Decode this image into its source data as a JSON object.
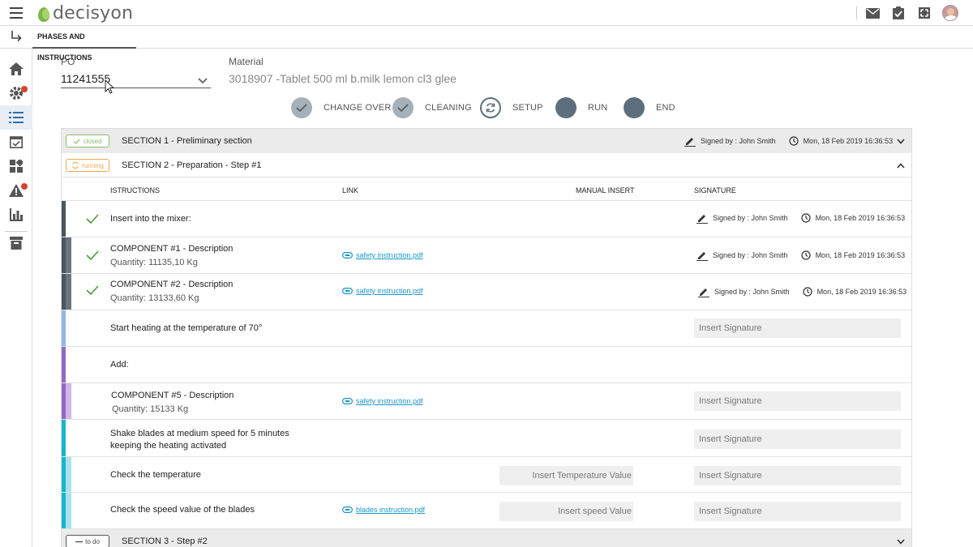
{
  "app": {
    "logo_text": "decisyon"
  },
  "subbar": {
    "tab_label": "PHASES AND INSTRUCTIONS"
  },
  "form": {
    "po_label": "PO",
    "po_value": "11241555",
    "material_label": "Material",
    "material_value": "3018907 -Tablet 500 ml b.milk lemon cl3 glee"
  },
  "phases": [
    {
      "label": "CHANGE OVER",
      "state": "done"
    },
    {
      "label": "CLEANING",
      "state": "done"
    },
    {
      "label": "SETUP",
      "state": "current"
    },
    {
      "label": "RUN",
      "state": "pending"
    },
    {
      "label": "END",
      "state": "pending"
    }
  ],
  "sections": {
    "s1": {
      "status": "closed",
      "title": "SECTION 1 -  Preliminary section",
      "signed": "Signed by : John Smith",
      "date": "Mon, 18 Feb 2019 16:36:53"
    },
    "s2": {
      "status": "running",
      "title": "SECTION 2 -  Preparation  - Step #1"
    },
    "s3": {
      "status": "to do",
      "title": "SECTION 3 -  Step #2"
    }
  },
  "columns": {
    "instructions": "ISTRUCTIONS",
    "link": "LINK",
    "manual": "MANUAL INSERT",
    "signature": "SIGNATURE"
  },
  "rows": [
    {
      "text": "Insert into the mixer:",
      "signed": "Signed by : John Smith",
      "date": "Mon, 18 Feb 2019 16:36:53"
    },
    {
      "text": "COMPONENT #1 - Description",
      "qty": "Quantity: 11135,10  Kg",
      "link": "safety instruction.pdf",
      "signed": "Signed by : John Smith",
      "date": "Mon, 18 Feb 2019 16:36:53"
    },
    {
      "text": "COMPONENT #2 - Description",
      "qty": "Quantity: 13133,60  Kg",
      "link": "safety instruction.pdf",
      "signed": "Signed by : John Smith",
      "date": "Mon, 18 Feb 2019 16:36:53"
    },
    {
      "text": "Start heating at the temperature of 70°",
      "signature_placeholder": "Insert Signature"
    },
    {
      "text": "Add:"
    },
    {
      "text": "COMPONENT #5 - Description",
      "qty": "Quantity: 15133  Kg",
      "link": "safety instruction.pdf",
      "signature_placeholder": "Insert Signature"
    },
    {
      "text": "Shake blades at medium speed for 5 minutes",
      "text2": "keeping the heating activated",
      "signature_placeholder": "Insert Signature"
    },
    {
      "text": "Check the temperature",
      "manual_placeholder": "Insert Temperature Value",
      "signature_placeholder": "Insert Signature"
    },
    {
      "text": "Check the speed value of the blades",
      "link": "blades instruction.pdf",
      "manual_placeholder": "Insert speed Value",
      "signature_placeholder": "Insert Signature"
    }
  ],
  "colors": {
    "closed": "#8bbf6e",
    "running": "#eea94f",
    "link": "#1a96c8",
    "check": "#4f9a3c",
    "phase_done": "#a5b0b8",
    "phase_pending": "#5d6f7c",
    "badge": "#d9412f"
  },
  "icons": {
    "top": [
      "mail-icon",
      "checklist-icon",
      "fullscreen-icon",
      "user-avatar"
    ],
    "sidebar": [
      "home-icon",
      "settings-icon",
      "list-icon",
      "calendar-check-icon",
      "dashboard-icon",
      "warning-icon",
      "bar-chart-icon",
      "archive-icon"
    ]
  }
}
